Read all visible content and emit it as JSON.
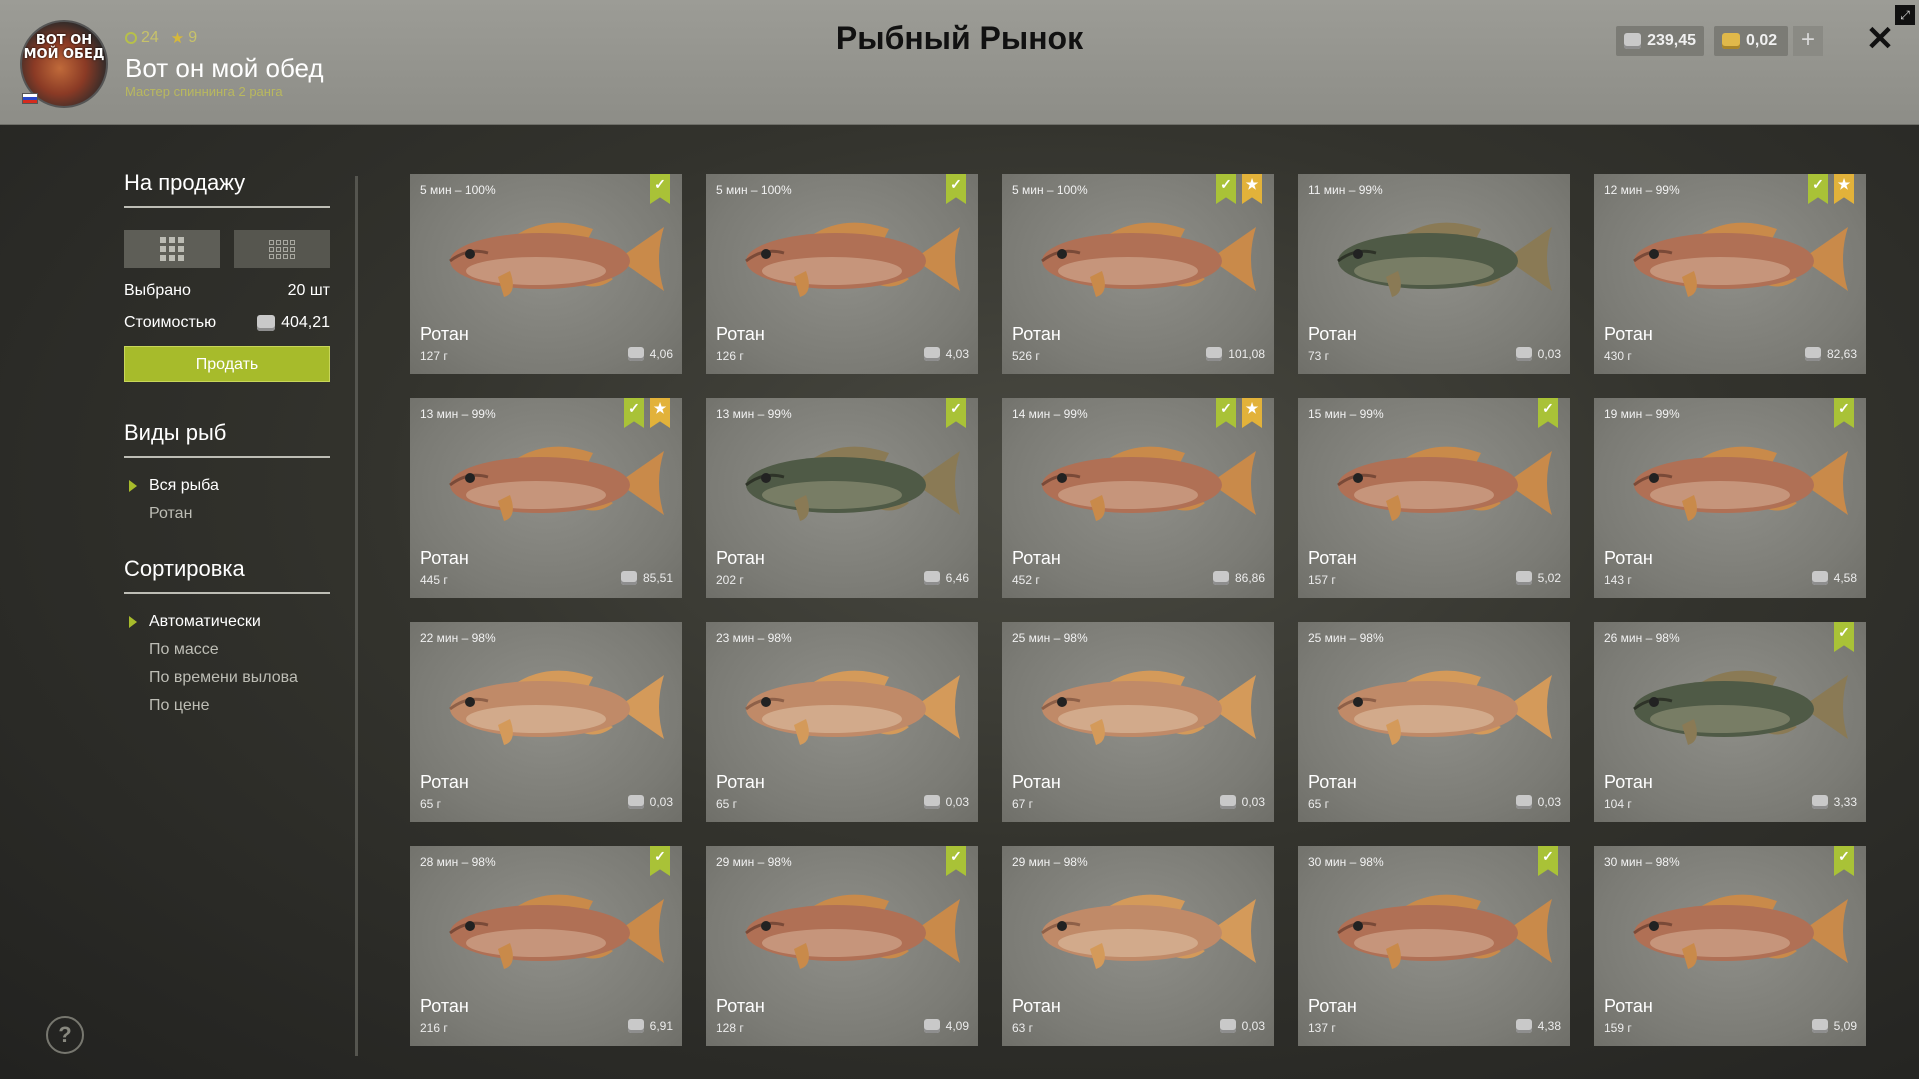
{
  "header": {
    "title": "Рыбный Рынок",
    "player": {
      "avatar_text": "ВОТ ОН МОЙ ОБЕД",
      "level": "24",
      "stars": "9",
      "name": "Вот он мой обед",
      "rank": "Мастер спиннинга 2 ранга"
    },
    "currency": {
      "silver": "239,45",
      "gold": "0,02"
    },
    "plus_label": "+",
    "close_label": "✕"
  },
  "sidebar": {
    "for_sale_heading": "На продажу",
    "selected_label": "Выбрано",
    "selected_value": "20 шт",
    "cost_label": "Стоимостью",
    "cost_value": "404,21",
    "sell_button": "Продать",
    "species_heading": "Виды рыб",
    "species": [
      "Вся рыба",
      "Ротан"
    ],
    "sort_heading": "Сортировка",
    "sort_options": [
      "Автоматически",
      "По массе",
      "По времени вылова",
      "По цене"
    ],
    "help_label": "?"
  },
  "colors": {
    "accent": "#a7bb2b",
    "star": "#e2b23a"
  },
  "fish": [
    {
      "time": "5 мин – 100%",
      "name": "Ротан",
      "weight": "127 г",
      "price": "4,06",
      "check": true,
      "star": false,
      "variant": "red"
    },
    {
      "time": "5 мин – 100%",
      "name": "Ротан",
      "weight": "126 г",
      "price": "4,03",
      "check": true,
      "star": false,
      "variant": "red"
    },
    {
      "time": "5 мин – 100%",
      "name": "Ротан",
      "weight": "526 г",
      "price": "101,08",
      "check": true,
      "star": true,
      "variant": "red"
    },
    {
      "time": "11 мин – 99%",
      "name": "Ротан",
      "weight": "73 г",
      "price": "0,03",
      "check": false,
      "star": false,
      "variant": "dark"
    },
    {
      "time": "12 мин – 99%",
      "name": "Ротан",
      "weight": "430 г",
      "price": "82,63",
      "check": true,
      "star": true,
      "variant": "red"
    },
    {
      "time": "13 мин – 99%",
      "name": "Ротан",
      "weight": "445 г",
      "price": "85,51",
      "check": true,
      "star": true,
      "variant": "red"
    },
    {
      "time": "13 мин – 99%",
      "name": "Ротан",
      "weight": "202 г",
      "price": "6,46",
      "check": true,
      "star": false,
      "variant": "dark"
    },
    {
      "time": "14 мин – 99%",
      "name": "Ротан",
      "weight": "452 г",
      "price": "86,86",
      "check": true,
      "star": true,
      "variant": "red"
    },
    {
      "time": "15 мин – 99%",
      "name": "Ротан",
      "weight": "157 г",
      "price": "5,02",
      "check": true,
      "star": false,
      "variant": "red"
    },
    {
      "time": "19 мин – 99%",
      "name": "Ротан",
      "weight": "143 г",
      "price": "4,58",
      "check": true,
      "star": false,
      "variant": "red"
    },
    {
      "time": "22 мин – 98%",
      "name": "Ротан",
      "weight": "65 г",
      "price": "0,03",
      "check": false,
      "star": false,
      "variant": "pale"
    },
    {
      "time": "23 мин – 98%",
      "name": "Ротан",
      "weight": "65 г",
      "price": "0,03",
      "check": false,
      "star": false,
      "variant": "pale"
    },
    {
      "time": "25 мин – 98%",
      "name": "Ротан",
      "weight": "67 г",
      "price": "0,03",
      "check": false,
      "star": false,
      "variant": "pale"
    },
    {
      "time": "25 мин – 98%",
      "name": "Ротан",
      "weight": "65 г",
      "price": "0,03",
      "check": false,
      "star": false,
      "variant": "pale"
    },
    {
      "time": "26 мин – 98%",
      "name": "Ротан",
      "weight": "104 г",
      "price": "3,33",
      "check": true,
      "star": false,
      "variant": "dark"
    },
    {
      "time": "28 мин – 98%",
      "name": "Ротан",
      "weight": "216 г",
      "price": "6,91",
      "check": true,
      "star": false,
      "variant": "red"
    },
    {
      "time": "29 мин – 98%",
      "name": "Ротан",
      "weight": "128 г",
      "price": "4,09",
      "check": true,
      "star": false,
      "variant": "red"
    },
    {
      "time": "29 мин – 98%",
      "name": "Ротан",
      "weight": "63 г",
      "price": "0,03",
      "check": false,
      "star": false,
      "variant": "pale"
    },
    {
      "time": "30 мин – 98%",
      "name": "Ротан",
      "weight": "137 г",
      "price": "4,38",
      "check": true,
      "star": false,
      "variant": "red"
    },
    {
      "time": "30 мин – 98%",
      "name": "Ротан",
      "weight": "159 г",
      "price": "5,09",
      "check": true,
      "star": false,
      "variant": "red"
    }
  ]
}
